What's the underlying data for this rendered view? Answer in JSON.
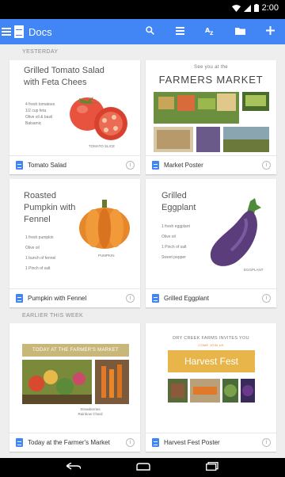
{
  "status_bar": {
    "time": "2:00"
  },
  "app_bar": {
    "title": "Docs",
    "icons": [
      "menu-icon",
      "docs-logo-icon",
      "search-icon",
      "list-view-icon",
      "sort-icon",
      "folder-icon",
      "add-icon"
    ]
  },
  "sections": [
    {
      "label": "Yesterday"
    },
    {
      "label": "Earlier this week"
    }
  ],
  "cards": [
    {
      "name": "Tomato Salad",
      "thumb": {
        "title_line1": "Grilled Tomato Salad",
        "title_line2": "with Feta Chees",
        "caption": "TOMATO SLICE",
        "lines": [
          "4 fresh tomatoes",
          "1/2 cup feta",
          "Olive oil & basil",
          "Balsamic"
        ]
      }
    },
    {
      "name": "Market Poster",
      "thumb": {
        "title_small": "See you at the",
        "title_big": "FARMERS MARKET"
      }
    },
    {
      "name": "Pumpkin with Fennel",
      "thumb": {
        "title_line1": "Roasted",
        "title_line2": "Pumpkin with",
        "title_line3": "Fennel",
        "caption": "PUMPKIN",
        "lines": [
          "1 fresh pumpkin",
          "Olive oil",
          "1 bunch of fennel",
          "1 Pinch of salt"
        ]
      }
    },
    {
      "name": "Grilled Eggplant",
      "thumb": {
        "title_line1": "Grilled",
        "title_line2": "Eggplant",
        "caption": "EGGPLANT",
        "lines": [
          "1 fresh eggplant",
          "Olive oil",
          "1 Pinch of salt",
          "Sweet pepper"
        ]
      }
    },
    {
      "name": "Today at the Farmer's Market",
      "thumb": {
        "banner": "TODAY AT THE FARMER'S MARKET",
        "caption_line1": "Strawberries",
        "caption_line2": "Rainbow Chard"
      }
    },
    {
      "name": "Harvest Fest Poster",
      "thumb": {
        "title_small": "DRY CREEK FARMS INVITES YOU",
        "subtitle": "COME JOIN US",
        "title_big": "Harvest Fest"
      }
    }
  ],
  "colors": {
    "accent": "#4285f4",
    "banner": "#e8b54a",
    "background": "#eeeeee"
  }
}
